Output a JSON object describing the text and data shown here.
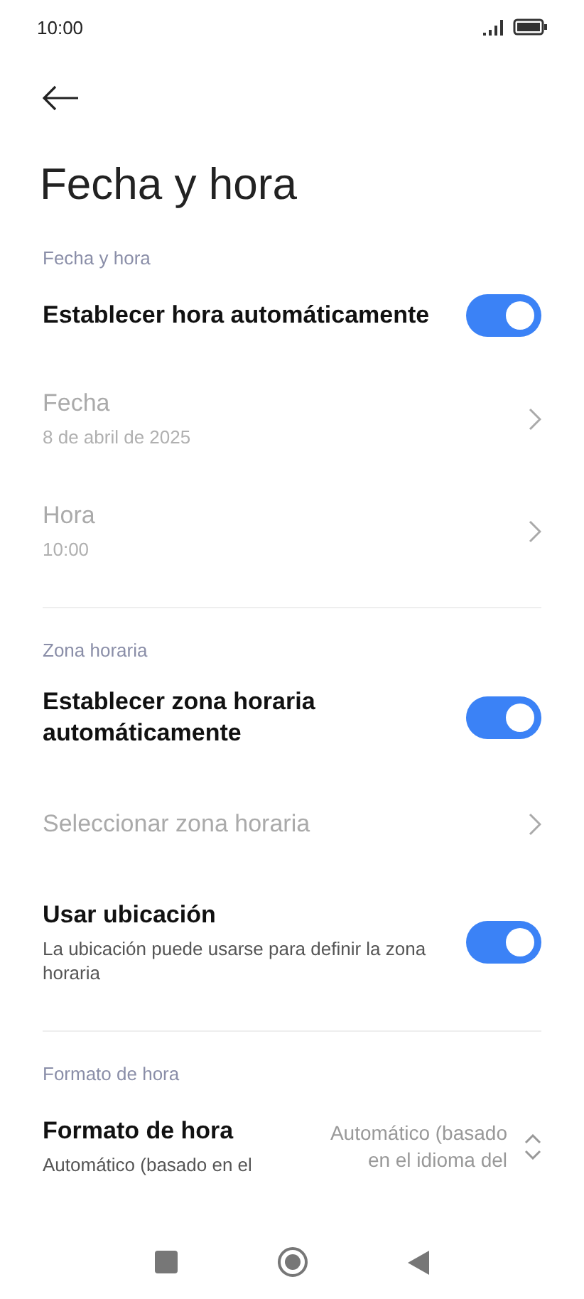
{
  "status_bar": {
    "time": "10:00"
  },
  "title": "Fecha y hora",
  "sections": [
    {
      "header": "Fecha y hora",
      "items": [
        {
          "kind": "toggle",
          "label": "Establecer hora automáticamente",
          "on": true,
          "disabled": false
        },
        {
          "kind": "nav",
          "label": "Fecha",
          "subtitle": "8 de abril de 2025",
          "disabled": true
        },
        {
          "kind": "nav",
          "label": "Hora",
          "subtitle": "10:00",
          "disabled": true
        }
      ]
    },
    {
      "header": "Zona horaria",
      "items": [
        {
          "kind": "toggle",
          "label": "Establecer zona horaria automáticamente",
          "on": true,
          "disabled": false
        },
        {
          "kind": "nav",
          "label": "Seleccionar zona horaria",
          "disabled": true
        },
        {
          "kind": "toggle",
          "label": "Usar ubicación",
          "subtitle": "La ubicación puede usarse para definir la zona horaria",
          "on": true,
          "disabled": false
        }
      ]
    },
    {
      "header": "Formato de hora",
      "items": [
        {
          "kind": "select",
          "label": "Formato de hora",
          "subtitle": "Automático (basado en el",
          "value": "Automático (basado en el idioma del",
          "disabled": false
        }
      ]
    }
  ]
}
